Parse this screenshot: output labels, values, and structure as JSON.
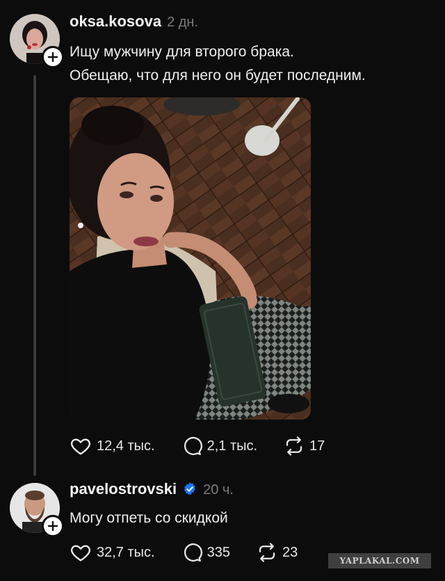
{
  "post1": {
    "username": "oksa.kosova",
    "time": "2 дн.",
    "text_line1": "Ищу мужчину для второго брака.",
    "text_line2": "Обещаю, что для него он будет последним.",
    "image_alt": "Selfie photo",
    "likes": "12,4 тыс.",
    "comments": "2,1 тыс.",
    "reposts": "17"
  },
  "post2": {
    "username": "pavelostrovski",
    "verified": true,
    "time": "20 ч.",
    "text": "Могу отпеть со скидкой",
    "likes": "32,7 тыс.",
    "comments": "335",
    "reposts": "23"
  },
  "watermark": "YAPLAKAL.COM",
  "colors": {
    "background": "#0c0c0c",
    "verified": "#1877f2",
    "muted": "#7b7b7b"
  },
  "icons": {
    "like": "heart-icon",
    "comment": "comment-bubble-icon",
    "repost": "repost-icon",
    "follow": "plus-icon"
  }
}
